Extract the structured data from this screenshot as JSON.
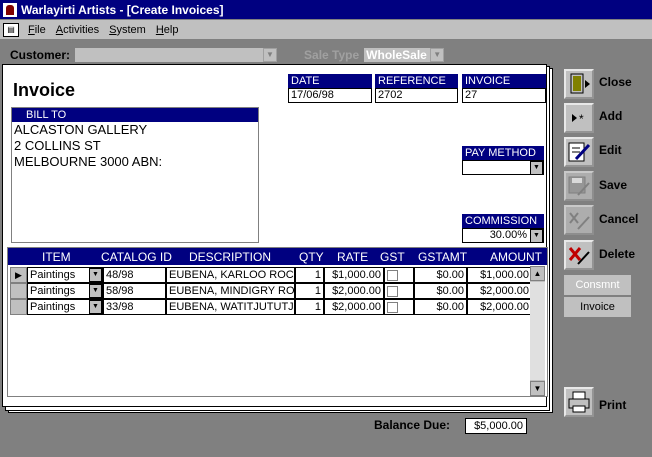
{
  "window": {
    "title": "Warlayirti Artists - [Create Invoices]"
  },
  "menu": {
    "items": [
      {
        "accel": "F",
        "rest": "ile"
      },
      {
        "accel": "A",
        "rest": "ctivities"
      },
      {
        "accel": "S",
        "rest": "ystem"
      },
      {
        "accel": "H",
        "rest": "elp"
      }
    ]
  },
  "form": {
    "customer_label": "Customer:",
    "customer_value": "",
    "sale_type_label": "Sale Type",
    "sale_type_value": "WholeSale",
    "title": "Invoice",
    "date_label": "DATE",
    "date_value": "17/06/98",
    "reference_label": "REFERENCE",
    "reference_value": "2702",
    "invoice_label": "INVOICE",
    "invoice_value": "27",
    "bill_to_label": "BILL TO",
    "bill_to_lines": [
      "ALCASTON GALLERY",
      "2 COLLINS ST",
      "MELBOURNE 3000 ABN:"
    ],
    "pay_method_label": "PAY METHOD",
    "pay_method_value": "",
    "commission_label": "COMMISSION",
    "commission_value": "30.00%"
  },
  "grid": {
    "columns": [
      "ITEM",
      "CATALOG ID",
      "DESCRIPTION",
      "QTY",
      "RATE",
      "GST",
      "GSTAMT",
      "AMOUNT"
    ],
    "rows": [
      {
        "item": "Paintings",
        "catalog": "48/98",
        "description": "EUBENA, KARLOO ROCK",
        "qty": "1",
        "rate": "$1,000.00",
        "gst": false,
        "gstamt": "$0.00",
        "amount": "$1,000.00"
      },
      {
        "item": "Paintings",
        "catalog": "58/98",
        "description": "EUBENA, MINDIGRY ROC",
        "qty": "1",
        "rate": "$2,000.00",
        "gst": false,
        "gstamt": "$0.00",
        "amount": "$2,000.00"
      },
      {
        "item": "Paintings",
        "catalog": "33/98",
        "description": "EUBENA, WATITJUTUTJ",
        "qty": "1",
        "rate": "$2,000.00",
        "gst": false,
        "gstamt": "$0.00",
        "amount": "$2,000.00"
      }
    ]
  },
  "sidebar": {
    "close": "Close",
    "add": "Add",
    "edit": "Edit",
    "save": "Save",
    "cancel": "Cancel",
    "delete": "Delete",
    "consmnt": "Consmnt",
    "invoice": "Invoice",
    "print": "Print"
  },
  "footer": {
    "balance_label": "Balance Due:",
    "balance_value": "$5,000.00"
  }
}
